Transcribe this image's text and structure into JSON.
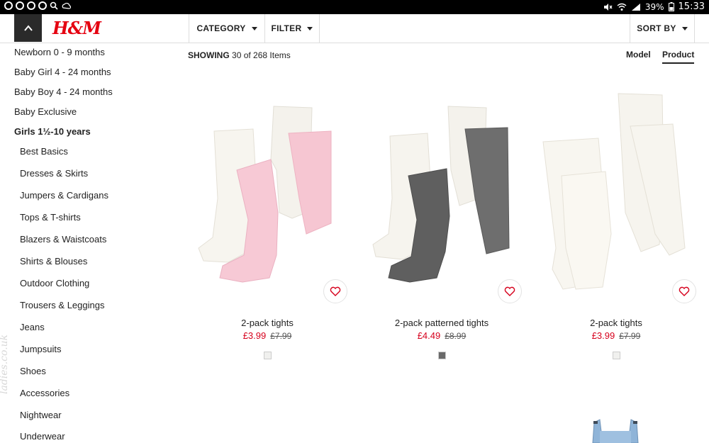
{
  "status_bar": {
    "battery": "39%",
    "time": "15:33"
  },
  "header": {
    "logo": "H&M",
    "category_label": "CATEGORY",
    "filter_label": "FILTER",
    "sort_label": "SORT BY"
  },
  "sidebar": {
    "top_items": [
      {
        "label": "Newborn 0 - 9 months"
      },
      {
        "label": "Baby Girl 4 - 24 months"
      },
      {
        "label": "Baby Boy 4 - 24 months"
      },
      {
        "label": "Baby Exclusive"
      },
      {
        "label": "Girls 1½-10 years"
      }
    ],
    "sub_items": [
      {
        "label": "Best Basics"
      },
      {
        "label": "Dresses & Skirts"
      },
      {
        "label": "Jumpers & Cardigans"
      },
      {
        "label": "Tops & T-shirts"
      },
      {
        "label": "Blazers & Waistcoats"
      },
      {
        "label": "Shirts & Blouses"
      },
      {
        "label": "Outdoor Clothing"
      },
      {
        "label": "Trousers & Leggings"
      },
      {
        "label": "Jeans"
      },
      {
        "label": "Jumpsuits"
      },
      {
        "label": "Shoes"
      },
      {
        "label": "Accessories"
      },
      {
        "label": "Nightwear"
      },
      {
        "label": "Underwear"
      }
    ],
    "watermark": "ladies.co.uk"
  },
  "results": {
    "showing_label": "SHOWING",
    "showing_text": "30 of 268 Items",
    "view_model": "Model",
    "view_product": "Product"
  },
  "products": [
    {
      "name": "2-pack tights",
      "price": "£3.99",
      "old_price": "£7.99",
      "swatch_color": "#f0f0ee"
    },
    {
      "name": "2-pack patterned tights",
      "price": "£4.49",
      "old_price": "£8.99",
      "swatch_color": "#6a6a6a"
    },
    {
      "name": "2-pack tights",
      "price": "£3.99",
      "old_price": "£7.99",
      "swatch_color": "#f0f0ee"
    }
  ],
  "colors": {
    "accent_red": "#e50010",
    "price_red": "#d6001c"
  }
}
